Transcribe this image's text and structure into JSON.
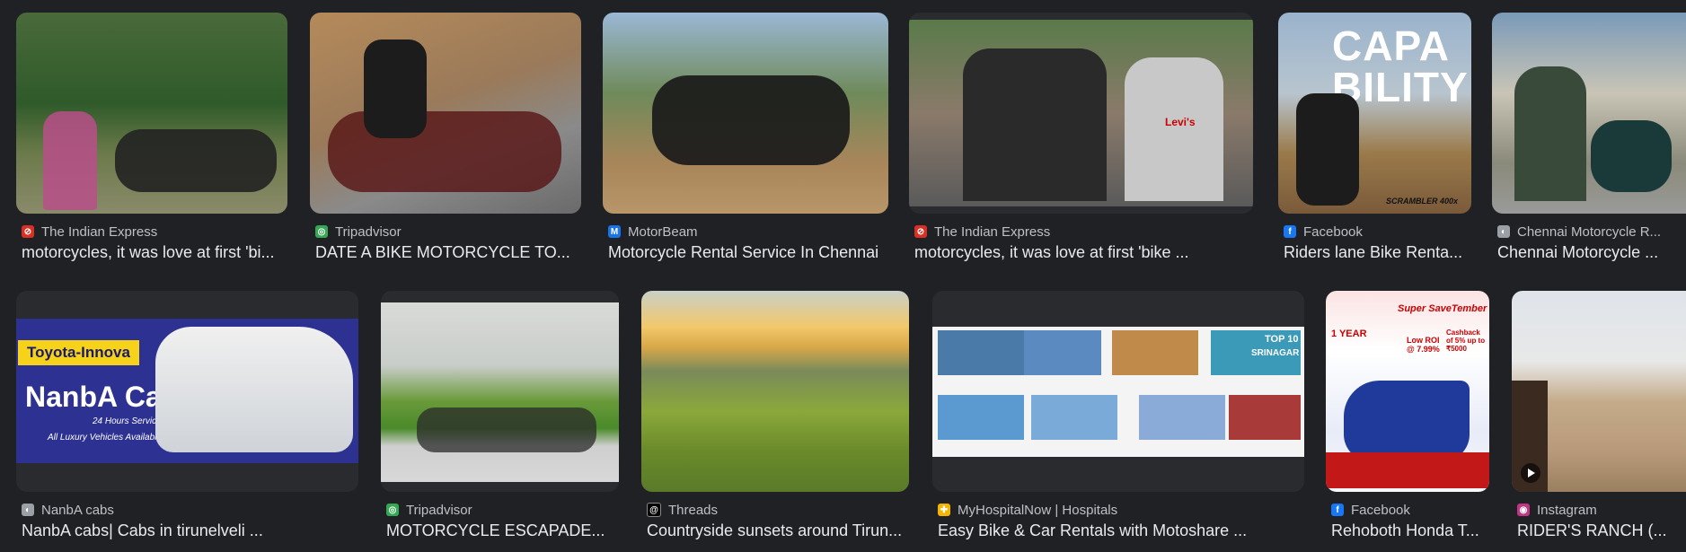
{
  "results": [
    {
      "source": "The Indian Express",
      "title": "motorcycles, it was love at first 'bi...",
      "favicon": "indian-express-icon",
      "fav_color": "#d93025"
    },
    {
      "source": "Tripadvisor",
      "title": "DATE A BIKE MOTORCYCLE TO...",
      "favicon": "tripadvisor-icon",
      "fav_color": "#34a853"
    },
    {
      "source": "MotorBeam",
      "title": "Motorcycle Rental Service In Chennai",
      "favicon": "motorbeam-icon",
      "fav_color": "#1a73e8"
    },
    {
      "source": "The Indian Express",
      "title": "motorcycles, it was love at first 'bike ...",
      "favicon": "indian-express-icon",
      "fav_color": "#d93025"
    },
    {
      "source": "Facebook",
      "title": "Riders lane Bike Renta...",
      "favicon": "facebook-icon",
      "fav_color": "#1877f2"
    },
    {
      "source": "Chennai Motorcycle R...",
      "title": "Chennai Motorcycle ...",
      "favicon": "globe-icon",
      "fav_color": "#9aa0a6"
    },
    {
      "source": "NanbA cabs",
      "title": "NanbA cabs| Cabs in tirunelveli ...",
      "favicon": "globe-icon",
      "fav_color": "#9aa0a6"
    },
    {
      "source": "Tripadvisor",
      "title": "MOTORCYCLE ESCAPADE...",
      "favicon": "tripadvisor-icon",
      "fav_color": "#34a853"
    },
    {
      "source": "Threads",
      "title": "Countryside sunsets around Tirun...",
      "favicon": "threads-icon",
      "fav_color": "#000000"
    },
    {
      "source": "MyHospitalNow | Hospitals",
      "title": "Easy Bike & Car Rentals with Motoshare ...",
      "favicon": "myhospitalnow-icon",
      "fav_color": "#f4b400"
    },
    {
      "source": "Facebook",
      "title": "Rehoboth Honda T...",
      "favicon": "facebook-icon",
      "fav_color": "#1877f2"
    },
    {
      "source": "Instagram",
      "title": "RIDER'S RANCH (...",
      "favicon": "instagram-icon",
      "fav_color": "#c13584"
    }
  ],
  "image_text": {
    "nanba_tag": "Toyota-Innova",
    "nanba_name": "NanbA Cabs",
    "nanba_sub1": "24 Hours Service",
    "nanba_sub2": "All Luxury Vehicles Available",
    "capa": "CAPA",
    "bility": "BILITY",
    "scrambler": "SCRAMBLER 400x",
    "top10": "TOP 10",
    "srinagar": "SRINAGAR",
    "honda_super": "Super SaveTember",
    "honda_year": "1 YEAR",
    "honda_roi": "Low ROI @ 7.99%",
    "honda_cash": "Cashback of 5% up to ₹5000",
    "levis": "Levi's"
  }
}
